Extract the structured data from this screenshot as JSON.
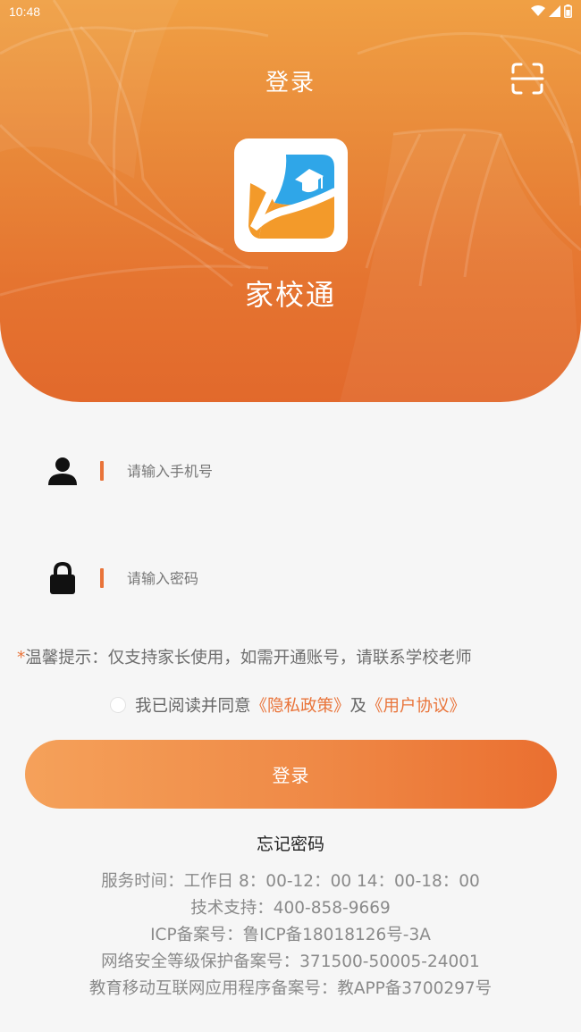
{
  "status_bar": {
    "time": "10:48",
    "icons": [
      "wifi-icon",
      "signal-icon",
      "battery-icon"
    ]
  },
  "header": {
    "title": "登录",
    "scan_icon": "scan-icon",
    "app_name": "家校通",
    "logo_icon": "app-logo-icon"
  },
  "form": {
    "phone": {
      "icon": "user-icon",
      "placeholder": "请输入手机号",
      "value": ""
    },
    "password": {
      "icon": "lock-icon",
      "placeholder": "请输入密码",
      "value": ""
    },
    "tip_star": "*",
    "tip_text": "温馨提示：仅支持家长使用，如需开通账号，请联系学校老师",
    "agreement": {
      "checked": false,
      "prefix": "我已阅读并同意",
      "privacy_link": "《隐私政策》",
      "middle": "及",
      "terms_link": "《用户协议》"
    },
    "login_label": "登录",
    "forgot_label": "忘记密码"
  },
  "footer": {
    "lines": [
      "服务时间：工作日 8：00-12：00 14：00-18：00",
      "技术支持：400-858-9669",
      "ICP备案号：鲁ICP备18018126号-3A",
      "网络安全等级保护备案号：371500-50005-24001",
      "教育移动互联网应用程序备案号：教APP备3700297号"
    ]
  },
  "colors": {
    "accent": "#e9743a",
    "header_top": "#f0a044",
    "header_bottom": "#e2692c",
    "page_bg": "#f6f6f6",
    "logo_blue": "#2fa6e8",
    "logo_orange": "#f39a2a"
  }
}
